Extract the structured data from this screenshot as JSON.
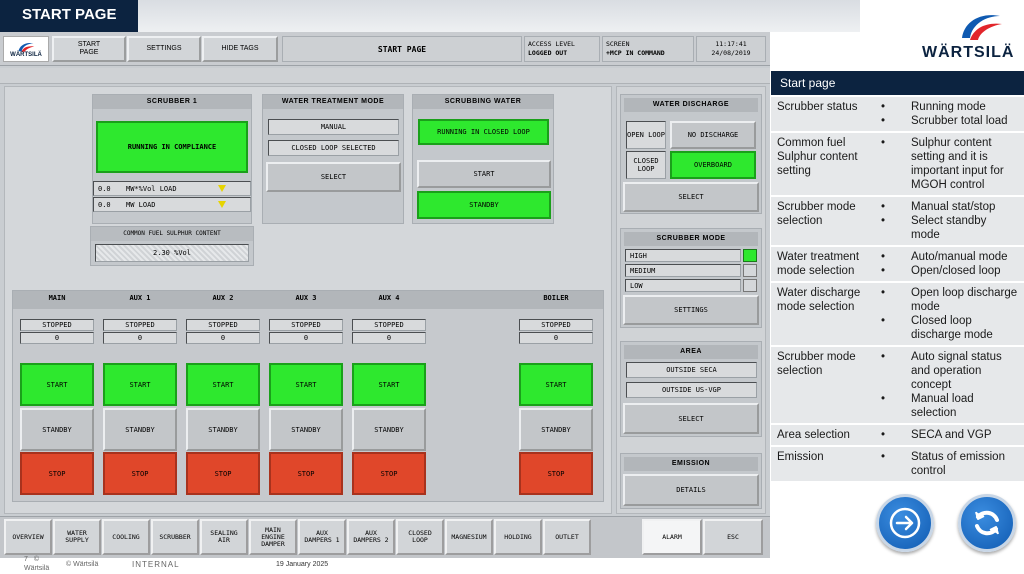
{
  "slide": {
    "title": "START PAGE",
    "footer_page": "7",
    "footer_copy": "©",
    "footer_brand": "Wärtsilä",
    "footer_copyright": "© Wärtsilä",
    "footer_internal": "INTERNAL",
    "footer_date": "19 January 2025",
    "logo_text": "WÄRTSILÄ"
  },
  "header": {
    "logo_text": "WÄRTSILÄ",
    "buttons": [
      "START PAGE",
      "SETTINGS",
      "HIDE TAGS"
    ],
    "screen_title": "START PAGE",
    "access_label": "ACCESS LEVEL",
    "access_value": "LOGGED OUT",
    "screen_label": "SCREEN",
    "screen_value": "+MCP IN COMMAND",
    "time": "11:17:41",
    "date": "24/08/2019"
  },
  "scrubber": {
    "title": "SCRUBBER 1",
    "status": "RUNNING IN COMPLIANCE",
    "load_rows": [
      {
        "value": "0.0",
        "label": "MW*%Vol LOAD"
      },
      {
        "value": "0.0",
        "label": "MW LOAD"
      }
    ]
  },
  "fuel": {
    "title": "COMMON FUEL SULPHUR CONTENT",
    "value": "2.30 %Vol"
  },
  "water_treatment": {
    "title": "WATER TREATMENT MODE",
    "mode": "MANUAL",
    "loop": "CLOSED LOOP SELECTED",
    "select": "SELECT"
  },
  "scrubbing_water": {
    "title": "SCRUBBING WATER",
    "status": "RUNNING IN CLOSED LOOP",
    "start": "START",
    "standby": "STANDBY"
  },
  "water_discharge": {
    "title": "WATER DISCHARGE",
    "open_label": "OPEN LOOP",
    "open_value": "NO DISCHARGE",
    "closed_label": "CLOSED LOOP",
    "closed_value": "OVERBOARD",
    "select": "SELECT"
  },
  "scrubber_mode": {
    "title": "SCRUBBER MODE",
    "levels": [
      "HIGH",
      "MEDIUM",
      "LOW"
    ],
    "settings": "SETTINGS"
  },
  "area": {
    "title": "AREA",
    "items": [
      "OUTSIDE SECA",
      "OUTSIDE US-VGP"
    ],
    "select": "SELECT"
  },
  "emission": {
    "title": "EMISSION",
    "details": "DETAILS"
  },
  "engines": [
    {
      "name": "MAIN",
      "status": "STOPPED",
      "value": "0",
      "start": "START",
      "standby": "STANDBY",
      "stop": "STOP"
    },
    {
      "name": "AUX 1",
      "status": "STOPPED",
      "value": "0",
      "start": "START",
      "standby": "STANDBY",
      "stop": "STOP"
    },
    {
      "name": "AUX 2",
      "status": "STOPPED",
      "value": "0",
      "start": "START",
      "standby": "STANDBY",
      "stop": "STOP"
    },
    {
      "name": "AUX 3",
      "status": "STOPPED",
      "value": "0",
      "start": "START",
      "standby": "STANDBY",
      "stop": "STOP"
    },
    {
      "name": "AUX 4",
      "status": "STOPPED",
      "value": "0",
      "start": "START",
      "standby": "STANDBY",
      "stop": "STOP"
    },
    {
      "name": "BOILER",
      "status": "STOPPED",
      "value": "0",
      "start": "START",
      "standby": "STANDBY",
      "stop": "STOP"
    }
  ],
  "bottom_tabs": [
    "OVERVIEW",
    "WATER SUPPLY",
    "COOLING",
    "SCRUBBER",
    "SEALING AIR",
    "MAIN ENGINE DAMPER",
    "AUX DAMPERS 1",
    "AUX DAMPERS 2",
    "CLOSED LOOP",
    "MAGNESIUM",
    "HOLDING",
    "OUTLET"
  ],
  "alarm": "ALARM",
  "esc": "ESC",
  "side_table": {
    "header": "Start page",
    "rows": [
      {
        "label": "Scrubber status",
        "bullets": [
          "Running mode",
          "Scrubber total load"
        ]
      },
      {
        "label": "Common fuel Sulphur content setting",
        "bullets": [
          "Sulphur content setting and it is important input for MGOH control"
        ]
      },
      {
        "label": "Scrubber mode selection",
        "bullets": [
          "Manual stat/stop",
          "Select standby mode"
        ]
      },
      {
        "label": "Water treatment mode selection",
        "bullets": [
          "Auto/manual mode",
          "Open/closed loop"
        ]
      },
      {
        "label": "Water discharge mode selection",
        "bullets": [
          "Open loop discharge mode",
          "Closed loop discharge mode"
        ]
      },
      {
        "label": "Scrubber mode selection",
        "bullets": [
          "Auto signal status and operation concept",
          "Manual load selection"
        ]
      },
      {
        "label": "Area selection",
        "bullets": [
          "SECA and VGP"
        ]
      },
      {
        "label": "Emission",
        "bullets": [
          "Status of emission control"
        ]
      }
    ]
  },
  "colors": {
    "navy": "#0c2340",
    "green": "#2ee82e",
    "red": "#e0472a",
    "accent": "#0f5ab1"
  }
}
